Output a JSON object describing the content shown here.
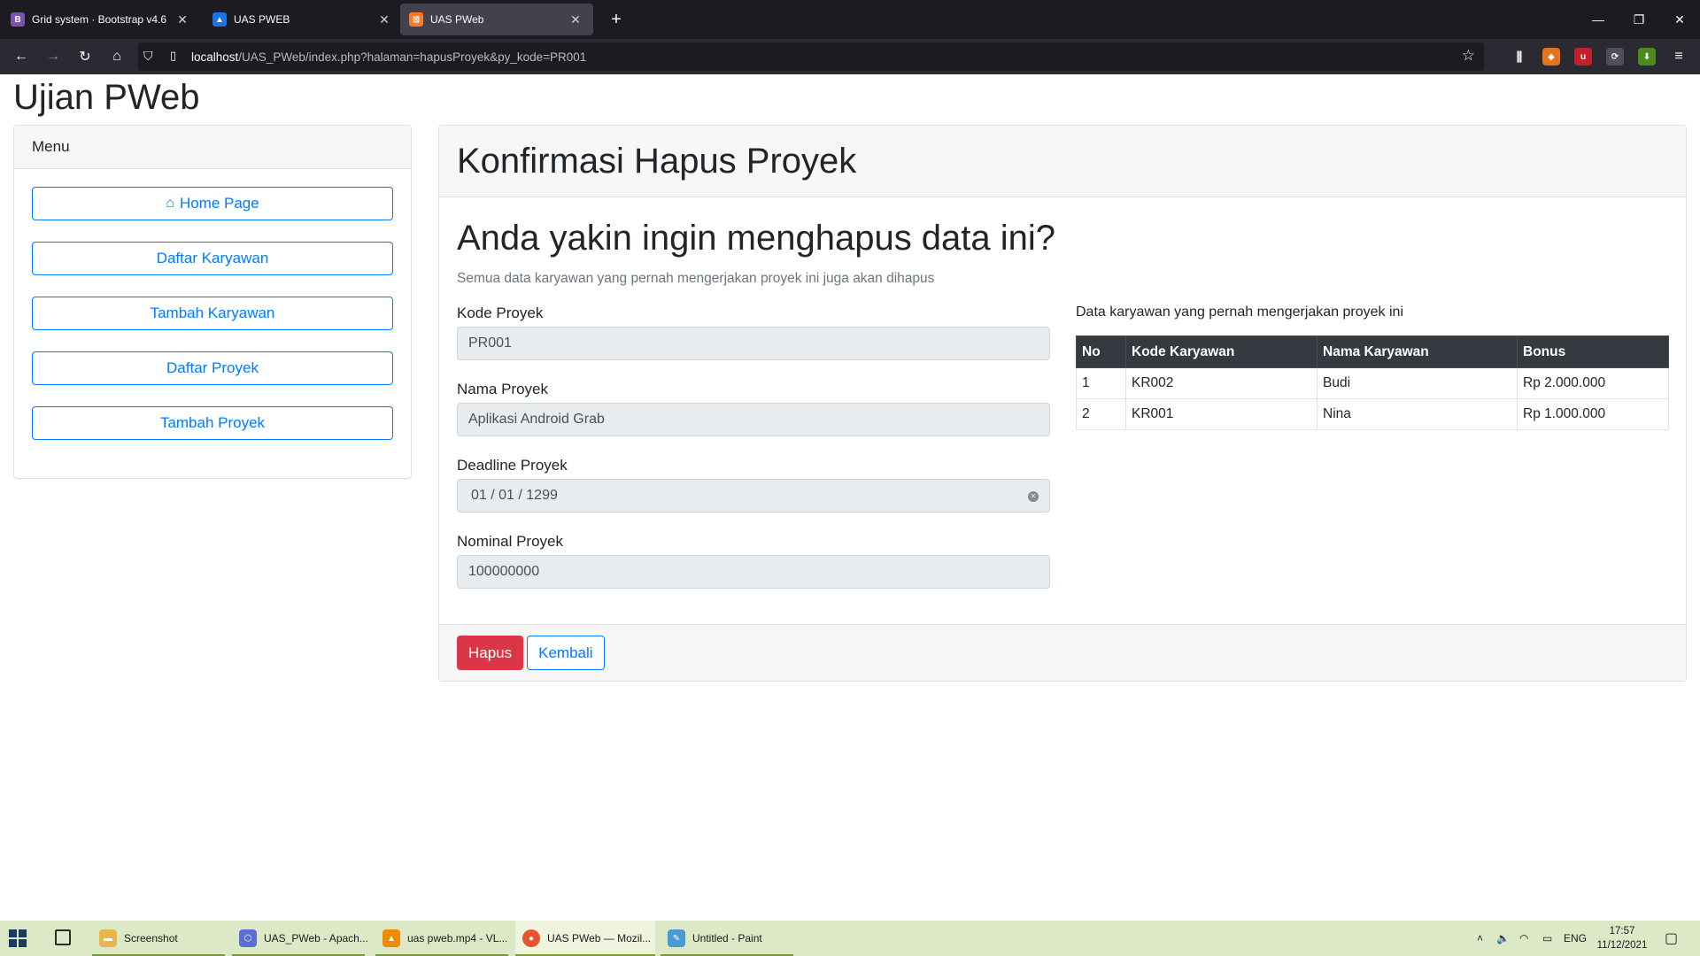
{
  "browser": {
    "tabs": [
      {
        "title": "Grid system · Bootstrap v4.6",
        "favicon": "B",
        "favicon_color": "#7952b3",
        "active": false
      },
      {
        "title": "UAS PWEB",
        "favicon": "▲",
        "favicon_color": "#1a73e8",
        "active": false
      },
      {
        "title": "UAS PWeb",
        "favicon": "⊠",
        "favicon_color": "#fb7a24",
        "active": true
      }
    ],
    "url_host": "localhost",
    "url_rest": "/UAS_PWeb/index.php?halaman=hapusProyek&py_kode=PR001"
  },
  "page": {
    "brand": "Ujian PWeb",
    "menu": {
      "title": "Menu",
      "items": [
        {
          "label": "Home Page",
          "icon": "home-icon"
        },
        {
          "label": "Daftar Karyawan"
        },
        {
          "label": "Tambah Karyawan"
        },
        {
          "label": "Daftar Proyek"
        },
        {
          "label": "Tambah Proyek"
        }
      ]
    },
    "main": {
      "header": "Konfirmasi Hapus Proyek",
      "question": "Anda yakin ingin menghapus data ini?",
      "subtitle": "Semua data karyawan yang pernah mengerjakan proyek ini juga akan dihapus",
      "fields": [
        {
          "label": "Kode Proyek",
          "value": "PR001"
        },
        {
          "label": "Nama Proyek",
          "value": "Aplikasi Android Grab"
        },
        {
          "label": "Deadline Proyek",
          "value": "01 / 01 / 1299"
        },
        {
          "label": "Nominal Proyek",
          "value": "100000000"
        }
      ],
      "table": {
        "title": "Data karyawan yang pernah mengerjakan proyek ini",
        "headers": [
          "No",
          "Kode Karyawan",
          "Nama Karyawan",
          "Bonus"
        ],
        "rows": [
          [
            "1",
            "KR002",
            "Budi",
            "Rp 2.000.000"
          ],
          [
            "2",
            "KR001",
            "Nina",
            "Rp 1.000.000"
          ]
        ]
      },
      "buttons": {
        "delete": "Hapus",
        "back": "Kembali"
      }
    }
  },
  "taskbar": {
    "apps": [
      {
        "label": "Screenshot",
        "icon": "folder-icon",
        "color": "#e8b64a"
      },
      {
        "label": "UAS_PWeb - Apach...",
        "icon": "netbeans-icon",
        "color": "#5b6fd6"
      },
      {
        "label": "uas pweb.mp4 - VL...",
        "icon": "vlc-icon",
        "color": "#f08a00"
      },
      {
        "label": "UAS PWeb — Mozil...",
        "icon": "firefox-icon",
        "color": "#e8542e"
      },
      {
        "label": "Untitled - Paint",
        "icon": "paint-icon",
        "color": "#4a9ad4"
      }
    ],
    "lang": "ENG",
    "time": "17:57",
    "date": "11/12/2021"
  }
}
